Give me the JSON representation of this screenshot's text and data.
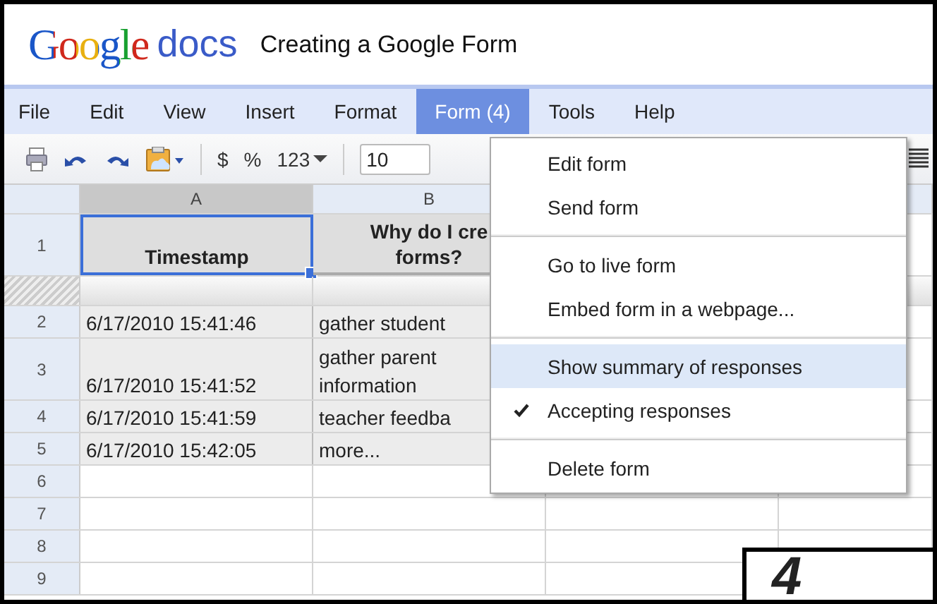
{
  "header": {
    "logo_word": "Google",
    "logo_product": "docs",
    "document_title": "Creating a Google Form"
  },
  "menu_bar": [
    {
      "label": "File",
      "selected": false
    },
    {
      "label": "Edit",
      "selected": false
    },
    {
      "label": "View",
      "selected": false
    },
    {
      "label": "Insert",
      "selected": false
    },
    {
      "label": "Format",
      "selected": false
    },
    {
      "label": "Form (4)",
      "selected": true
    },
    {
      "label": "Tools",
      "selected": false
    },
    {
      "label": "Help",
      "selected": false
    }
  ],
  "toolbar": {
    "currency": "$",
    "percent": "%",
    "number_format": "123",
    "font_size": "10"
  },
  "sheet": {
    "columns": [
      {
        "label": "A",
        "selected": true
      },
      {
        "label": "B",
        "selected": false
      }
    ],
    "rows": [
      {
        "number": "1",
        "kind": "header",
        "cells": [
          "Timestamp",
          "Why do I cre\nforms?"
        ]
      },
      {
        "number": "",
        "kind": "frozen",
        "cells": [
          "",
          ""
        ]
      },
      {
        "number": "2",
        "kind": "data",
        "cells": [
          "6/17/2010 15:41:46",
          "gather student"
        ]
      },
      {
        "number": "3",
        "kind": "tall",
        "cells": [
          "6/17/2010 15:41:52",
          "gather parent\ninformation"
        ]
      },
      {
        "number": "4",
        "kind": "data",
        "cells": [
          "6/17/2010 15:41:59",
          "teacher feedba"
        ]
      },
      {
        "number": "5",
        "kind": "data",
        "cells": [
          "6/17/2010 15:42:05",
          "more..."
        ]
      },
      {
        "number": "6",
        "kind": "empty",
        "cells": [
          "",
          ""
        ]
      },
      {
        "number": "7",
        "kind": "empty",
        "cells": [
          "",
          ""
        ]
      },
      {
        "number": "8",
        "kind": "empty",
        "cells": [
          "",
          ""
        ]
      },
      {
        "number": "9",
        "kind": "empty",
        "cells": [
          "",
          ""
        ]
      }
    ]
  },
  "form_menu": {
    "groups": [
      [
        {
          "label": "Edit form",
          "selected": false,
          "checked": false
        },
        {
          "label": "Send form",
          "selected": false,
          "checked": false
        }
      ],
      [
        {
          "label": "Go to live form",
          "selected": false,
          "checked": false
        },
        {
          "label": "Embed form in a webpage...",
          "selected": false,
          "checked": false
        }
      ],
      [
        {
          "label": "Show summary of responses",
          "selected": true,
          "checked": false
        },
        {
          "label": "Accepting responses",
          "selected": false,
          "checked": true
        }
      ],
      [
        {
          "label": "Delete form",
          "selected": false,
          "checked": false
        }
      ]
    ]
  },
  "step_badge": "4"
}
